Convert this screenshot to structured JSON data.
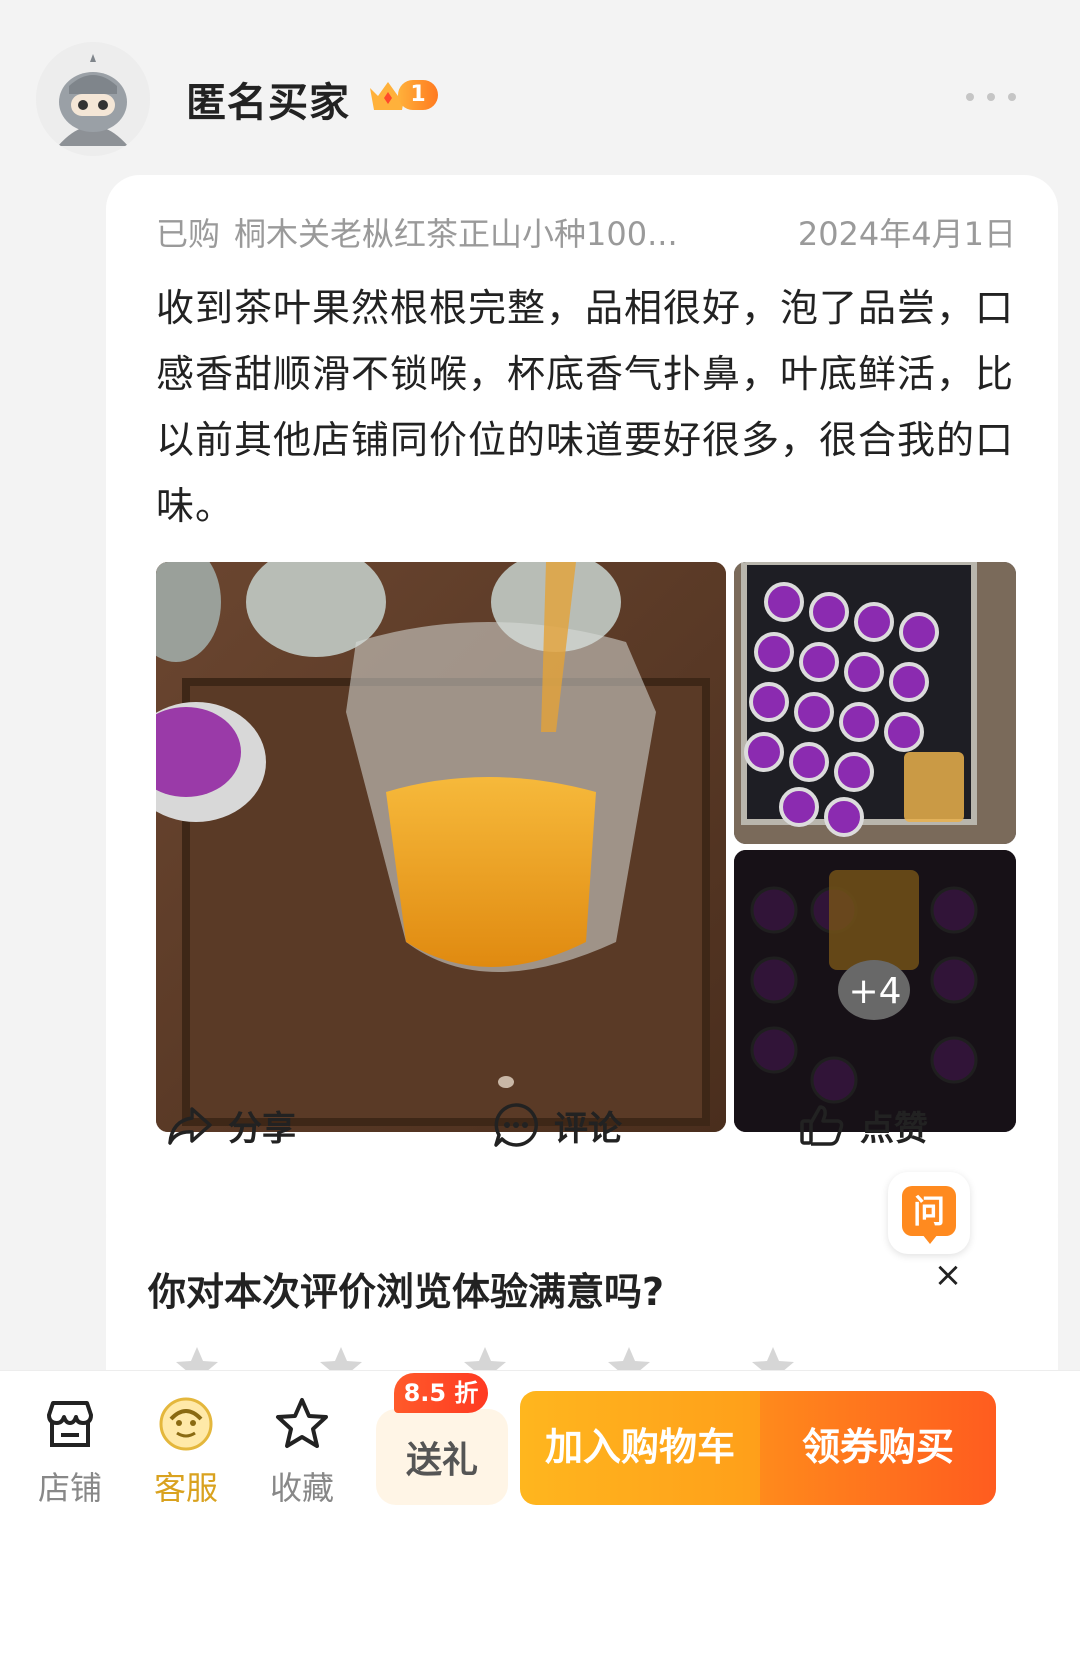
{
  "header": {
    "user_name": "匿名买家",
    "vip_level": "1",
    "avatar_icon": "anonymous-ninja-avatar"
  },
  "review": {
    "bought_label": "已购",
    "product_name": "桐木关老枞红茶正山小种100...",
    "date": "2024年4月1日",
    "text": "收到茶叶果然根根完整，品相很好，泡了品尝，口感香甜顺滑不锁喉，杯底香气扑鼻，叶底鲜活，比以前其他店铺同价位的味道要好很多，很合我的口味。",
    "more_photos": "+4",
    "actions": {
      "share": "分享",
      "comment": "评论",
      "like": "点赞"
    }
  },
  "ask_button": {
    "label": "问"
  },
  "survey": {
    "question": "你对本次评价浏览体验满意吗?",
    "close": "×",
    "stars": 5
  },
  "bottom_bar": {
    "shop": "店铺",
    "service": "客服",
    "favorite": "收藏",
    "gift": "送礼",
    "gift_discount": "8.5 折",
    "add_to_cart": "加入购物车",
    "coupon_buy": "领券购买"
  },
  "colors": {
    "accent_orange": "#ff6a1f",
    "cart_yellow": "#ffb61e",
    "service_gold": "#d9a21f"
  }
}
